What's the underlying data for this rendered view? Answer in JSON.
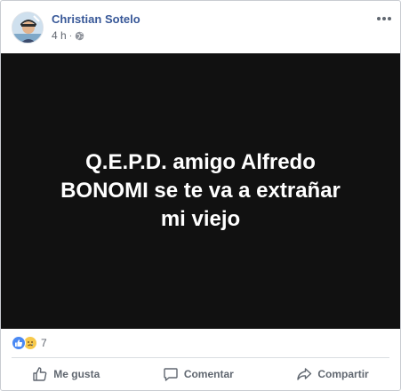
{
  "post": {
    "author": "Christian Sotelo",
    "time": "4 h",
    "separator": "·",
    "privacy_icon": "globe-icon",
    "more_icon": "more-options-icon",
    "media_text": "Q.E.P.D. amigo Alfredo BONOMI se te va a extrañar mi viejo",
    "media_background": "#111111"
  },
  "reactions": {
    "icons": [
      "like-icon",
      "sad-icon"
    ],
    "count": "7"
  },
  "actions": {
    "like_label": "Me gusta",
    "comment_label": "Comentar",
    "share_label": "Compartir"
  },
  "colors": {
    "author": "#385898",
    "meta": "#616770",
    "like_badge": "#4a89f3",
    "sad_badge": "#f7c94b"
  }
}
